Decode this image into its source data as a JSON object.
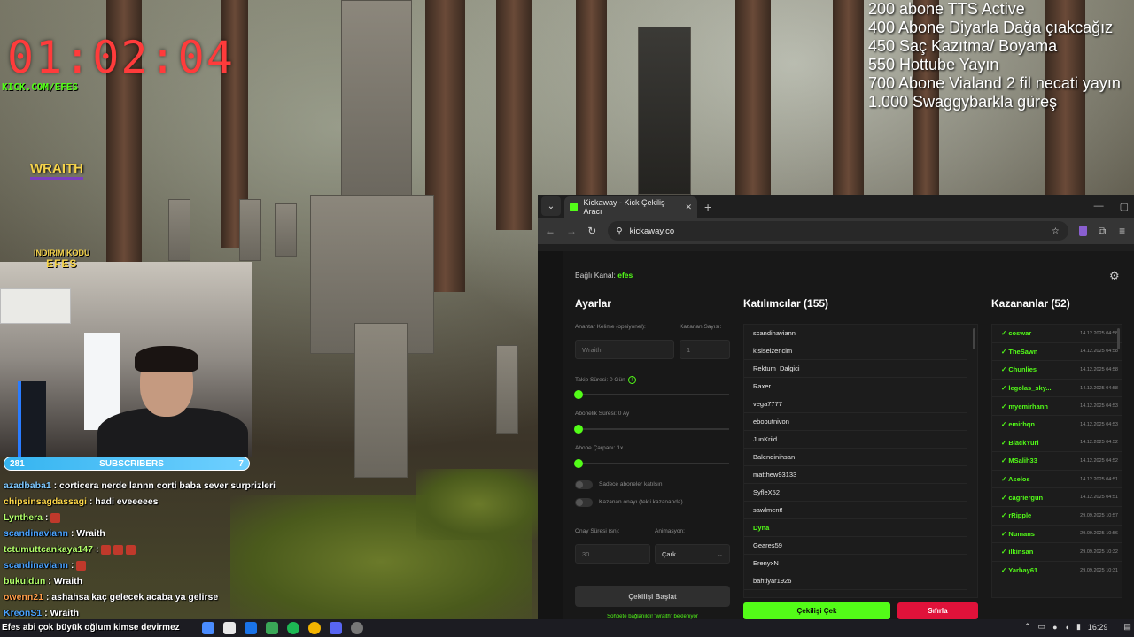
{
  "overlay": {
    "timer": "01:02:04",
    "kick_link": "KICK.COM/EFES",
    "brand_tag": "WRAITH",
    "discount": {
      "line1": "INDIRIM KODU",
      "line2": "EFES"
    },
    "goals": [
      "200 abone TTS Active",
      "400 Abone Diyarla Dağa çıakcağız",
      "450 Saç Kazıtma/ Boyama",
      "550 Hottube Yayın",
      "700 Abone Vialand 2 fil necati yayın",
      "1.000 Swaggybarkla güreş"
    ]
  },
  "subscribers": {
    "left": "281",
    "label": "SUBSCRIBERS",
    "right": "7"
  },
  "chat": [
    {
      "user": "azadbaba1",
      "color": "#7ec8ff",
      "text": ": corticera nerde lannn corti baba sever surprizleri",
      "emotes": 0
    },
    {
      "user": "chipsinsagdassagi",
      "color": "#ffd84a",
      "text": ": hadi eveeeees",
      "emotes": 0
    },
    {
      "user": "Lynthera",
      "color": "#b3ff6a",
      "text": ":",
      "emotes": 1
    },
    {
      "user": "scandinaviann",
      "color": "#4aa3ff",
      "text": ": Wraith",
      "emotes": 0
    },
    {
      "user": "tctumuttcankaya147",
      "color": "#b3ff6a",
      "text": ":",
      "emotes": 3
    },
    {
      "user": "scandinaviann",
      "color": "#4aa3ff",
      "text": ":",
      "emotes": 1
    },
    {
      "user": "bukuldun",
      "color": "#b3ff6a",
      "text": ": Wraith",
      "emotes": 0
    },
    {
      "user": "owenn21",
      "color": "#ff9f4a",
      "text": ": ashahsa kaç gelecek acaba ya gelirse",
      "emotes": 0
    },
    {
      "user": "KreonS1",
      "color": "#4aa3ff",
      "text": ": Wraith",
      "emotes": 0
    }
  ],
  "browser": {
    "tab_title": "Kickaway - Kick Çekiliş Aracı",
    "url": "kickaway.co"
  },
  "app": {
    "channel_label": "Bağlı Kanal:",
    "channel_name": "efes",
    "settings": {
      "title": "Ayarlar",
      "keyword_label": "Anahtar Kelime (opsiyonel):",
      "keyword_placeholder": "Wraith",
      "winner_count_label": "Kazanan Sayısı:",
      "winner_count_placeholder": "1",
      "follow_label": "Takip Süresi: 0 Gün",
      "follow_value": 0,
      "sub_label": "Abonelik Süresi: 0 Ay",
      "sub_value": 0,
      "multiplier_label": "Abone Çarpanı: 1x",
      "multiplier_value": 0,
      "toggle1": "Sadece aboneler katılsın",
      "toggle2": "Kazanan onayı (tekli kazananda)",
      "confirm_label": "Onay Süresi (sn):",
      "confirm_placeholder": "30",
      "animation_label": "Animasyon:",
      "animation_value": "Çark",
      "start_button": "Çekilişi Başlat",
      "wait_note": "Sohbete bağlanıldı! \"wraith\" bekleniyor"
    },
    "participants": {
      "title": "Katılımcılar (155)",
      "items": [
        "scandinaviann",
        "kisiselzencim",
        "Rektum_Dalgici",
        "Raxer",
        "vega7777",
        "ebobutnivon",
        "JunKriid",
        "Balendinihsan",
        "matthew93133",
        "SyfleX52",
        "sawlment!",
        "Dyna",
        "Geares59",
        "ErenyxN",
        "bahtiyar1926"
      ],
      "highlight": "Dyna"
    },
    "winners": {
      "title": "Kazananlar (52)",
      "items": [
        {
          "name": "✓ coswar",
          "date": "14.12.2025 04:58"
        },
        {
          "name": "✓ TheSawn",
          "date": "14.12.2025 04:58"
        },
        {
          "name": "✓ Chunlies",
          "date": "14.12.2025 04:58"
        },
        {
          "name": "✓ legolas_sky...",
          "date": "14.12.2025 04:58"
        },
        {
          "name": "✓ myemirhann",
          "date": "14.12.2025 04:53"
        },
        {
          "name": "✓ emirhqn",
          "date": "14.12.2025 04:53"
        },
        {
          "name": "✓ BlackYuri",
          "date": "14.12.2025 04:52"
        },
        {
          "name": "✓ MSalih33",
          "date": "14.12.2025 04:52"
        },
        {
          "name": "✓ Aselos",
          "date": "14.12.2025 04:51"
        },
        {
          "name": "✓ cagriergun",
          "date": "14.12.2025 04:51"
        },
        {
          "name": "✓ rRipple",
          "date": "29.09.2025 10:57"
        },
        {
          "name": "✓ Numans",
          "date": "29.09.2025 10:56"
        },
        {
          "name": "✓ ilkinsan",
          "date": "29.09.2025 10:32"
        },
        {
          "name": "✓ Yarbay61",
          "date": "29.09.2025 10:31"
        }
      ]
    },
    "draw_button": "Çekilişi Çek",
    "reset_button": "Sıfırla"
  },
  "taskbar": {
    "ticker": "Efes abi çok büyük oğlum kimse devirmez",
    "time": "16:29"
  },
  "colors": {
    "kick_green": "#53fc18",
    "timer_red": "#ff3b3b",
    "reset_red": "#e0123a",
    "sub_blue": "#35b4f0"
  }
}
